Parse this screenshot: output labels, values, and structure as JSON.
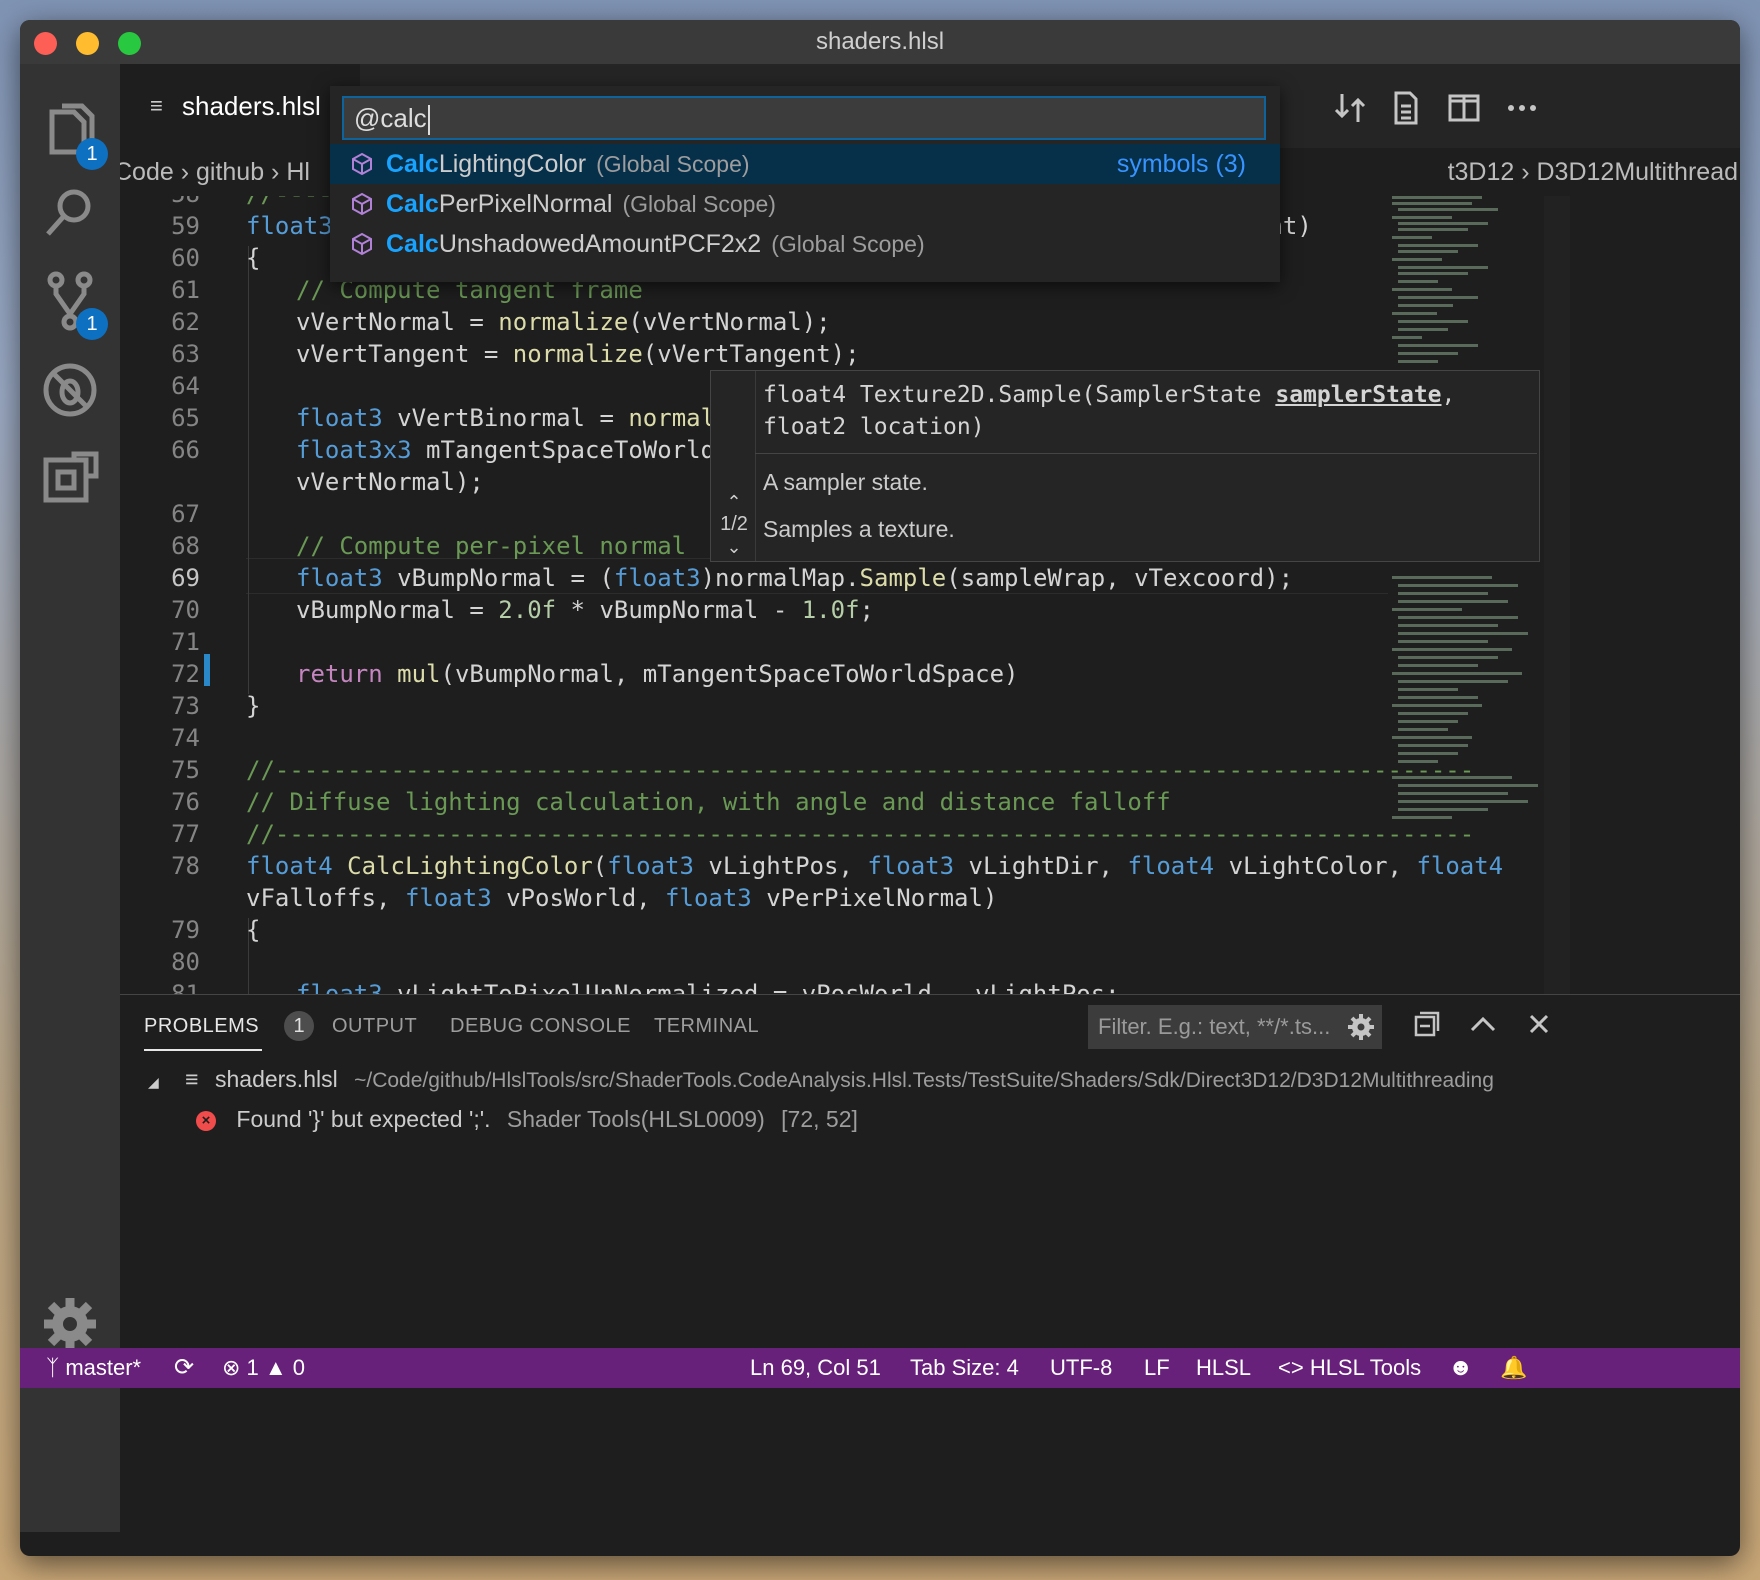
{
  "window": {
    "title": "shaders.hlsl"
  },
  "activity_bar": {
    "explorer_badge": "1",
    "scm_badge": "1"
  },
  "tab": {
    "label": "shaders.hlsl"
  },
  "breadcrumb": {
    "left": "Code › github › Hl",
    "right": "t3D12 › D3D12Multithread"
  },
  "quick_open": {
    "query": "@calc",
    "items": [
      {
        "match": "Calc",
        "rest": "LightingColor",
        "scope": "(Global Scope)",
        "kind": "symbols (3)"
      },
      {
        "match": "Calc",
        "rest": "PerPixelNormal",
        "scope": "(Global Scope)",
        "kind": ""
      },
      {
        "match": "Calc",
        "rest": "UnshadowedAmountPCF2x2",
        "scope": "(Global Scope)",
        "kind": ""
      }
    ]
  },
  "editor": {
    "line_numbers": [
      "58",
      "59",
      "60",
      "61",
      "62",
      "63",
      "64",
      "65",
      "66",
      "67",
      "68",
      "69",
      "70",
      "71",
      "72",
      "73",
      "74",
      "75",
      "76",
      "77",
      "78",
      "79",
      "80",
      "81"
    ],
    "code": {
      "l58": "//-----",
      "l59": "float3",
      "l59_end": "ent)",
      "l60": "{",
      "l61": "// Compute tangent frame",
      "l62a": "vVertNormal = ",
      "l62b": "normalize",
      "l62c": "(vVertNormal);",
      "l63a": "vVertTangent = ",
      "l63b": "normalize",
      "l63c": "(vVertTangent);",
      "l65a": "float3",
      "l65b": " vVertBinormal = ",
      "l65c": "normalize",
      "l66a": "float3x3",
      "l66b": " mTangentSpaceToWorldSpa",
      "l66w": "vVertNormal);",
      "l68": "// Compute per-pixel normal",
      "l69a": "float3",
      "l69b": " vBumpNormal = (",
      "l69c": "float3",
      "l69d": ")normalMap.",
      "l69e": "Sample",
      "l69f": "(sampleWrap, vTexcoord);",
      "l70a": "vBumpNormal = ",
      "l70b": "2.0f",
      "l70c": " * vBumpNormal - ",
      "l70d": "1.0f",
      "l70e": ";",
      "l72a": "return",
      "l72b": " ",
      "l72c": "mul",
      "l72d": "(vBumpNormal, mTangentSpaceToWorldSpace)",
      "l73": "}",
      "l75": "//-----------------------------------------------------------------------------------",
      "l76": "// Diffuse lighting calculation, with angle and distance falloff",
      "l77": "//-----------------------------------------------------------------------------------",
      "l78a": "float4",
      "l78b": " ",
      "l78c": "CalcLightingColor",
      "l78d": "(",
      "l78e": "float3",
      "l78f": " vLightPos, ",
      "l78g": "float3",
      "l78h": " vLightDir, ",
      "l78i": "float4",
      "l78j": " vLightColor, ",
      "l78k": "float4",
      "l78wa": "vFalloffs, ",
      "l78wb": "float3",
      "l78wc": " vPosWorld, ",
      "l78wd": "float3",
      "l78we": " vPerPixelNormal)",
      "l79": "{",
      "l81a": "float3",
      "l81b": " vLightToPixelUnNormalized = vPosWorld - vLightPos;"
    }
  },
  "parameter_hint": {
    "sig_before": "float4 Texture2D.Sample(SamplerState ",
    "sig_param": "samplerState",
    "sig_after": ", float2 location)",
    "param_doc": "A sampler state.",
    "func_doc": "Samples a texture.",
    "overload": "1/2"
  },
  "panel": {
    "tabs": [
      "PROBLEMS",
      "OUTPUT",
      "DEBUG CONSOLE",
      "TERMINAL"
    ],
    "problems_count": "1",
    "filter_placeholder": "Filter. E.g.: text, **/*.ts...",
    "file": "shaders.hlsl",
    "path": "~/Code/github/HlslTools/src/ShaderTools.CodeAnalysis.Hlsl.Tests/TestSuite/Shaders/Sdk/Direct3D12/D3D12Multithreading",
    "error_message": "Found '}' but expected ';'.",
    "error_source": "Shader Tools(HLSL0009)",
    "error_location": "[72, 52]"
  },
  "status_bar": {
    "branch": "master*",
    "errors": "1",
    "warnings": "0",
    "position": "Ln 69, Col 51",
    "tab_size": "Tab Size: 4",
    "encoding": "UTF-8",
    "eol": "LF",
    "language": "HLSL",
    "extension": "HLSL Tools"
  },
  "colors": {
    "status_bar": "#68217a",
    "accent": "#0e70c0",
    "error": "#f14c4c"
  }
}
